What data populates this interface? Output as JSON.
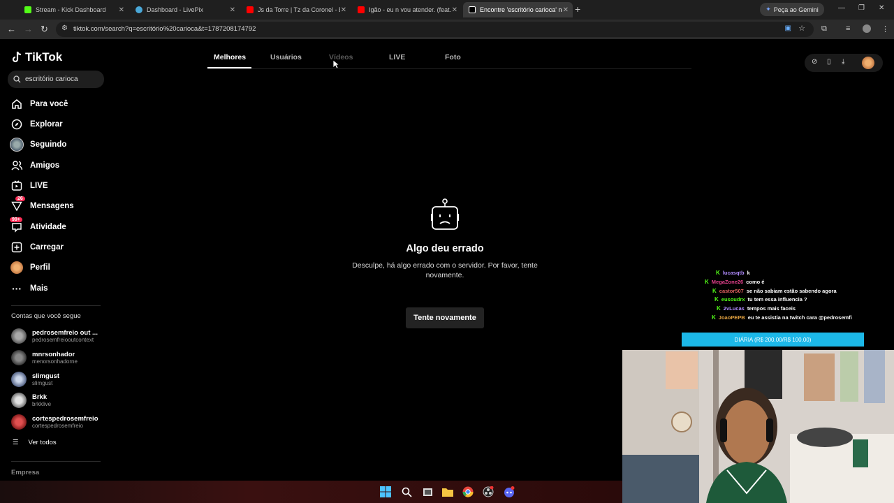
{
  "browser": {
    "tabs": [
      {
        "title": "Stream - Kick Dashboard",
        "color": "#53fc18",
        "active": false
      },
      {
        "title": "Dashboard - LivePix",
        "color": "#4aa8d8",
        "active": false
      },
      {
        "title": "Js da Torre | Tz da Coronel - Eu",
        "color": "#ff0000",
        "active": false
      },
      {
        "title": "Igão - eu n vou atender. (feat. V",
        "color": "#ff0000",
        "active": false
      },
      {
        "title": "Encontre 'escritório carioca' no",
        "color": "#ffffff",
        "active": true
      }
    ],
    "gemini_label": "Peça ao Gemini",
    "url": "tiktok.com/search?q=escritório%20carioca&t=1787208174792"
  },
  "tiktok": {
    "logo_text": "TikTok",
    "search_value": "escritório carioca",
    "nav": [
      {
        "label": "Para você",
        "icon": "home-icon"
      },
      {
        "label": "Explorar",
        "icon": "compass-icon"
      },
      {
        "label": "Seguindo",
        "icon": "following-avatar-icon"
      },
      {
        "label": "Amigos",
        "icon": "friends-icon"
      },
      {
        "label": "LIVE",
        "icon": "live-icon"
      },
      {
        "label": "Mensagens",
        "icon": "messages-icon",
        "badge": "26"
      },
      {
        "label": "Atividade",
        "icon": "activity-icon",
        "badge": "99+"
      },
      {
        "label": "Carregar",
        "icon": "upload-icon"
      },
      {
        "label": "Perfil",
        "icon": "profile-avatar-icon"
      },
      {
        "label": "Mais",
        "icon": "more-icon"
      }
    ],
    "following_title": "Contas que você segue",
    "following": [
      {
        "name": "pedrosemfreio out ...",
        "handle": "pedrosemfreiooutcontext"
      },
      {
        "name": "mnrsonhador",
        "handle": "menorsonhadorne"
      },
      {
        "name": "slimgust",
        "handle": "slimgust"
      },
      {
        "name": "Brkk",
        "handle": "brkklive"
      },
      {
        "name": "cortespedrosemfreio",
        "handle": "cortespedrosemfreio"
      }
    ],
    "see_all": "Ver todos",
    "company": "Empresa",
    "search_tabs": [
      "Melhores",
      "Usuários",
      "Vídeos",
      "LIVE",
      "Foto"
    ],
    "error": {
      "title": "Algo deu errado",
      "description": "Desculpe, há algo errado com o servidor. Por favor, tente novamente.",
      "retry": "Tente novamente"
    }
  },
  "stream_overlay": {
    "chat": [
      {
        "user": "lucasqtb",
        "user_color": "#b18cff",
        "text": "k"
      },
      {
        "user": "MegaZone26",
        "user_color": "#e0408a",
        "text": "como é"
      },
      {
        "user": "castor507",
        "user_color": "#e06060",
        "text": "se não sabiam estão sabendo agora"
      },
      {
        "user": "eusoudrx",
        "user_color": "#53fc18",
        "text": "tu tem essa influencia ?"
      },
      {
        "user": "2vLucas",
        "user_color": "#b18cff",
        "text": "tempos mais faceis"
      },
      {
        "user": "JoaoPEPB",
        "user_color": "#e0a040",
        "text": "eu te assistia na twitch cara @pedrosemfi"
      }
    ],
    "goal_text": "DIÁRIA (R$ 200.00/R$ 100.00)"
  }
}
